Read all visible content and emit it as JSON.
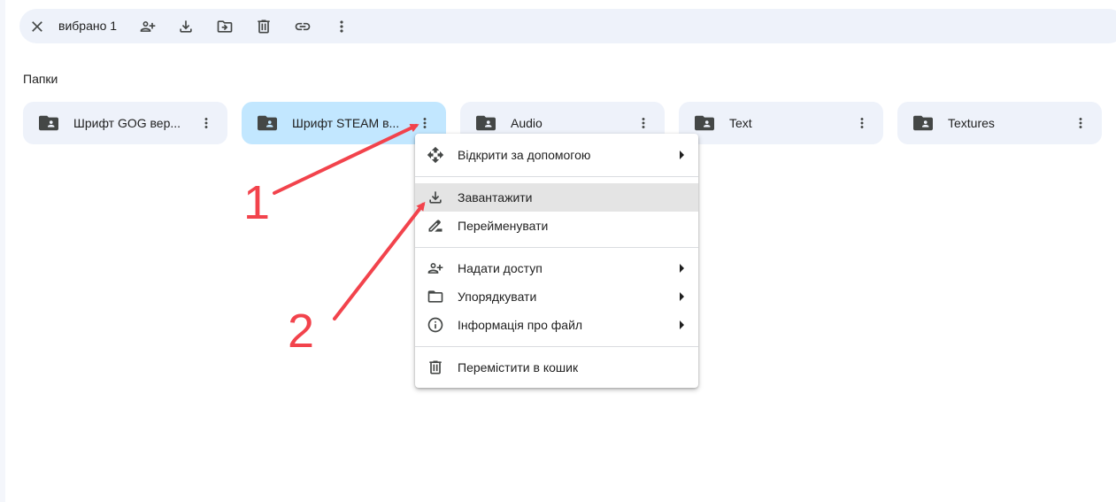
{
  "toolbar": {
    "selected_count": "вибрано 1",
    "icons": [
      "close-icon",
      "share-icon",
      "download-icon",
      "move-icon",
      "trash-icon",
      "link-icon",
      "more-vert-icon"
    ]
  },
  "section": {
    "title": "Папки"
  },
  "folders": [
    {
      "name": "Шрифт GOG вер...",
      "selected": false
    },
    {
      "name": "Шрифт STEAM в...",
      "selected": true
    },
    {
      "name": "Audio",
      "selected": false
    },
    {
      "name": "Text",
      "selected": false
    },
    {
      "name": "Textures",
      "selected": false
    }
  ],
  "context_menu": {
    "items": [
      {
        "label": "Відкрити за допомогою",
        "icon": "open-with-icon",
        "submenu": true
      },
      {
        "label": "Завантажити",
        "icon": "download-icon",
        "submenu": false,
        "hovered": true
      },
      {
        "label": "Перейменувати",
        "icon": "rename-icon",
        "submenu": false
      },
      {
        "label": "Надати доступ",
        "icon": "share-icon",
        "submenu": true
      },
      {
        "label": "Упорядкувати",
        "icon": "folder-open-icon",
        "submenu": true
      },
      {
        "label": "Інформація про файл",
        "icon": "info-icon",
        "submenu": true
      },
      {
        "label": "Перемістити в кошик",
        "icon": "trash-icon",
        "submenu": false
      }
    ]
  },
  "annotations": {
    "label_1": "1",
    "label_2": "2",
    "color": "#f2434c"
  },
  "colors": {
    "selected_folder": "#c2e7ff",
    "folder_bg": "#eef2fa",
    "toolbar_bg": "#eef2fa",
    "menu_hover": "#e4e4e4"
  }
}
